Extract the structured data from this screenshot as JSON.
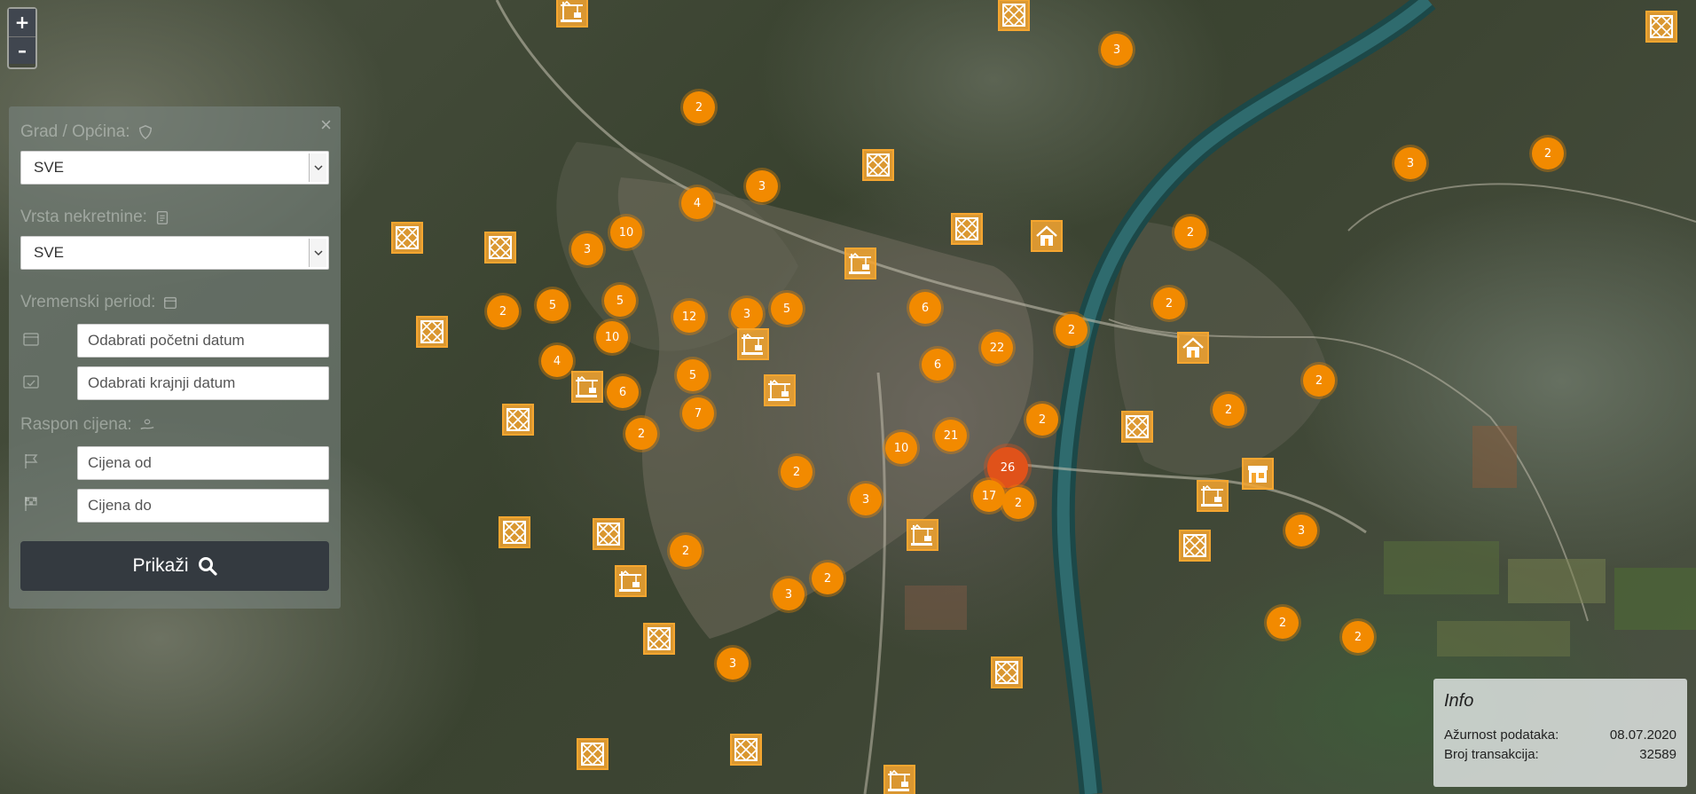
{
  "zoom": {
    "in_label": "+",
    "out_label": "–"
  },
  "filter": {
    "city_label": "Grad / Općina:",
    "city_value": "SVE",
    "type_label": "Vrsta nekretnine:",
    "type_value": "SVE",
    "period_label": "Vremenski period:",
    "start_placeholder": "Odabrati početni datum",
    "end_placeholder": "Odabrati krajnji datum",
    "price_label": "Raspon cijena:",
    "price_from_placeholder": "Cijena od",
    "price_to_placeholder": "Cijena do",
    "submit_label": "Prikaži",
    "close_label": "×"
  },
  "info": {
    "title": "Info",
    "updated_label": "Ažurnost podataka:",
    "updated_value": "08.07.2020",
    "count_label": "Broj transakcija:",
    "count_value": "32589"
  },
  "clusters": [
    "2",
    "3",
    "3",
    "4",
    "10",
    "3",
    "2",
    "5",
    "5",
    "12",
    "3",
    "5",
    "10",
    "4",
    "5",
    "6",
    "7",
    "2",
    "6",
    "6",
    "22",
    "2",
    "2",
    "10",
    "21",
    "26",
    "17",
    "2",
    "2",
    "3",
    "2",
    "2",
    "3",
    "3",
    "2",
    "2",
    "2",
    "2",
    "3",
    "2",
    "2",
    "3",
    "2"
  ],
  "markers": [
    "land",
    "land",
    "land",
    "land",
    "land",
    "land",
    "land",
    "land",
    "land",
    "land",
    "land",
    "land",
    "land",
    "land",
    "land",
    "land",
    "crane",
    "crane",
    "crane",
    "crane",
    "crane",
    "crane",
    "crane",
    "crane",
    "crane",
    "house",
    "house",
    "shop"
  ],
  "colors": {
    "cluster": "#f28a00",
    "cluster_large": "#e0521a",
    "marker": "#f6a630",
    "button": "#343a40"
  }
}
